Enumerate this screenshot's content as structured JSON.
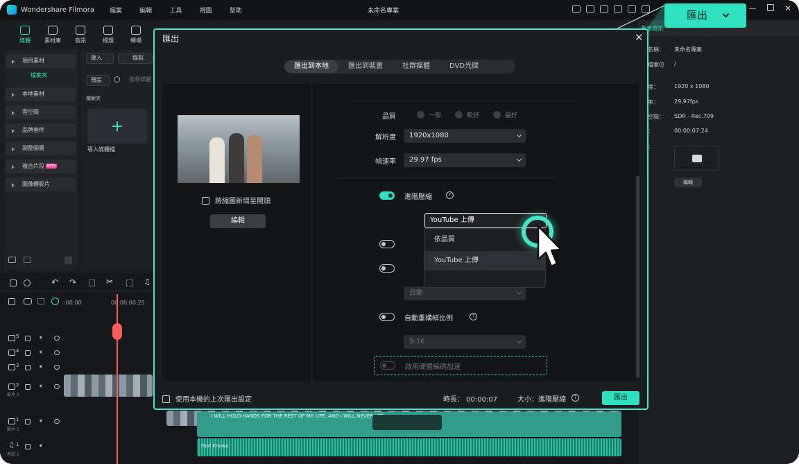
{
  "app": {
    "name": "Wondershare Filmora",
    "menu": [
      "檔案",
      "編輯",
      "工具",
      "視圖",
      "幫助"
    ],
    "project_title": "未命名專案"
  },
  "toolbar": [
    "媒體",
    "素材庫",
    "音訊",
    "標題",
    "轉場"
  ],
  "left_panel": {
    "items": [
      "項目素材",
      "本地素材",
      "雲空間",
      "品牌套件",
      "調整圖層",
      "複合片段",
      "圖像轉影片"
    ],
    "subitem": "檔案夾",
    "new_badge": "NEW"
  },
  "media_panel": {
    "import_btn": "匯入",
    "record_btn": "錄製",
    "preset_btn": "預設",
    "search_placeholder": "搜尋媒體",
    "folder_label": "檔案夾",
    "import_media_label": "導入媒體檔"
  },
  "right_panel": {
    "tabs": [
      "專案資訊"
    ],
    "rows": [
      {
        "label": "名稱：",
        "value": "未命名專案"
      },
      {
        "label": "檔案位",
        "value": "/"
      },
      {
        "label": "度：",
        "value": "1920 x 1080"
      },
      {
        "label": "率：",
        "value": "29.97fps"
      },
      {
        "label": "空間：",
        "value": "SDR - Rec.709"
      },
      {
        "label": "：",
        "value": "00:00:07:24"
      },
      {
        "label": "：",
        "value": ""
      }
    ],
    "edit_label": "編輯"
  },
  "timeline": {
    "time_start": ":00:00",
    "time_mark": "00:00:00:25",
    "tracks": [
      {
        "num": "5"
      },
      {
        "num": "4"
      },
      {
        "num": "3"
      },
      {
        "num": "2",
        "label": "影片 2"
      },
      {
        "num": "1",
        "label": "影片 1"
      },
      {
        "num": "1",
        "label": "音訊 1"
      }
    ],
    "subtitle_clip_text": "I WILL HOLD HANDS FOR THE REST OF MY LIFE, AND I WILL NEVER LET",
    "audio_clip_text": "God Knows"
  },
  "export_dialog": {
    "title": "匯出",
    "tabs": [
      "匯出到本地",
      "匯出到裝置",
      "社群媒體",
      "DVD光碟"
    ],
    "active_tab": 0,
    "thumbnail_checkbox": "將縮圖新增至開頭",
    "edit_button": "編輯",
    "quality": {
      "label": "品質",
      "options": [
        "一般",
        "較好",
        "最好"
      ]
    },
    "resolution": {
      "label": "解析度",
      "value": "1920x1080"
    },
    "framerate": {
      "label": "幀速率",
      "value": "29.97 fps"
    },
    "advanced_compression": {
      "label": "進階壓縮",
      "value": "YouTube 上傳",
      "options": [
        "依品質",
        "YouTube 上傳"
      ]
    },
    "hidden_select_value": "自動",
    "auto_reframe": {
      "label": "自動重構幀比例",
      "value": "9:16"
    },
    "hardware_accel": "啟用硬體編碼加速",
    "footer": {
      "use_last_settings": "使用本機的上次匯出設定",
      "duration": "時長：  00:00:07",
      "size": "大小：進階壓縮",
      "export": "匯出"
    }
  },
  "callout": {
    "label": "匯出"
  },
  "colors": {
    "accent": "#2fe1c0",
    "dialog_border": "#46e6c5"
  }
}
